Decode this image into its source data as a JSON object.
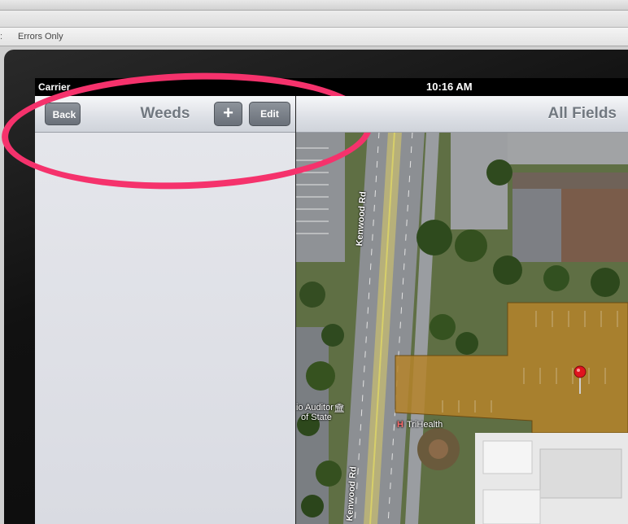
{
  "host_window": {
    "truncated_label": ":",
    "errors_filter": "Errors Only"
  },
  "status_bar": {
    "carrier": "Carrier",
    "time": "10:16 AM"
  },
  "master": {
    "title": "Weeds",
    "back_label": "Back",
    "add_label": "+",
    "edit_label": "Edit"
  },
  "detail": {
    "title": "All Fields"
  },
  "map": {
    "road_label_top": "Kenwood Rd",
    "road_label_bottom": "Kenwood Rd",
    "poi_auditor_line1": "io Auditor",
    "poi_auditor_line2": "of State",
    "poi_hospital": "TriHealth",
    "field_overlay_color": "#b5842a",
    "pin_color": "#e0141e"
  },
  "annotation": {
    "color": "#f5326c"
  }
}
